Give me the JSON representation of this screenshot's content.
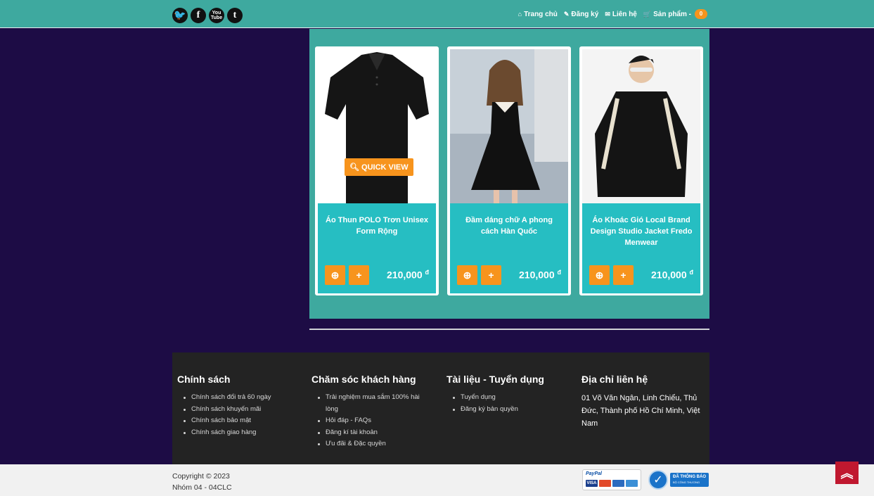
{
  "header": {
    "social": [
      "twitter-icon",
      "facebook-icon",
      "youtube-icon",
      "tumblr-icon"
    ],
    "social_glyphs": {
      "twitter": "t",
      "facebook": "f",
      "youtube": "You Tube",
      "tumblr": "t"
    },
    "nav": {
      "home": "Trang chủ",
      "register": "Đăng ký",
      "contact": "Liên hệ",
      "products": "Sản phẩm -",
      "cart_count": "0"
    }
  },
  "products": [
    {
      "name": "Áo Thun POLO Trơn Unisex Form Rộng",
      "price": "210,000",
      "currency": "đ"
    },
    {
      "name": "Đầm dáng chữ A phong cách Hàn Quốc",
      "price": "210,000",
      "currency": "đ"
    },
    {
      "name": "Áo Khoác Gió Local Brand Design Studio Jacket Fredo Menwear",
      "price": "210,000",
      "currency": "đ"
    }
  ],
  "quick_view": "QUICK VIEW",
  "footer": {
    "policy": {
      "title": "Chính sách",
      "items": [
        "Chính sách đổi trả 60 ngày",
        "Chính sách khuyến mãi",
        "Chính sách bảo mật",
        "Chính sách giao hàng"
      ]
    },
    "care": {
      "title": "Chăm sóc khách hàng",
      "items": [
        "Trải nghiệm mua sắm 100% hài lòng",
        "Hỏi đáp - FAQs",
        "Đăng kí tài khoản",
        "Ưu đãi & Đặc quyền"
      ]
    },
    "docs": {
      "title": "Tài liệu - Tuyển dụng",
      "items": [
        "Tuyển dụng",
        "Đăng ký bản quyền"
      ]
    },
    "address": {
      "title": "Địa chỉ liên hệ",
      "text": "01 Võ Văn Ngân, Linh Chiểu, Thủ Đức, Thành phố Hồ Chí Minh, Việt Nam"
    }
  },
  "bottom": {
    "copyright": "Copyright © 2023",
    "group": "Nhóm 04 - 04CLC",
    "paypal": "PayPal",
    "card_labels": [
      "VISA"
    ],
    "certify": "ĐÃ THÔNG BÁO",
    "certify_sub": "BỘ CÔNG THƯƠNG"
  },
  "colors": {
    "background": "#1d0c45",
    "teal": "#3ea99f",
    "card_info": "#26bec2",
    "accent": "#f7941d",
    "footer": "#232323",
    "to_top": "#c0182f"
  }
}
